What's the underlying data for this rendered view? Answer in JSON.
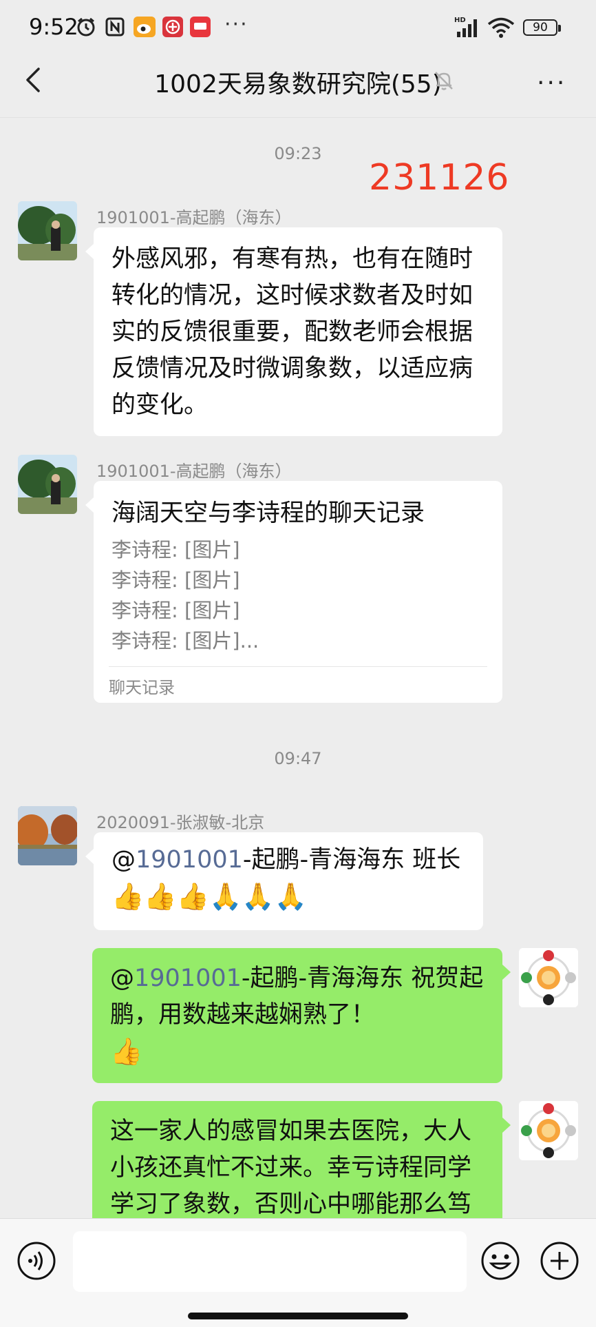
{
  "status_bar": {
    "time": "9:52",
    "battery": "90",
    "overflow": "···",
    "icons": [
      "alarm-icon",
      "nfc-icon",
      "weibo-icon",
      "app-icon",
      "news-app-icon",
      "hd-signal-icon",
      "wifi-icon",
      "battery-icon"
    ]
  },
  "header": {
    "title": "1002天易象数研究院(55)",
    "back_icon": "chevron-left-icon",
    "mute_icon": "bell-off-icon",
    "more_label": "···"
  },
  "stamp": "231126",
  "messages": [
    {
      "type": "time",
      "text": "09:23"
    },
    {
      "type": "text",
      "side": "left",
      "sender": "1901001-高起鹏（海东）",
      "lines": [
        "外感风邪，有寒有热，也有在随时",
        "转化的情况，这时候求数者及时如",
        "实的反馈很重要，配数老师会根据",
        "反馈情况及时微调象数，以适应病",
        "的变化。"
      ]
    },
    {
      "type": "record",
      "side": "left",
      "sender": "1901001-高起鹏（海东）",
      "title": "海阔天空与李诗程的聊天记录",
      "lines": [
        "李诗程: [图片]",
        "李诗程: [图片]",
        "李诗程: [图片]",
        "李诗程: [图片]..."
      ],
      "footer": "聊天记录"
    },
    {
      "type": "time",
      "text": "09:47"
    },
    {
      "type": "mention",
      "side": "left",
      "sender": "2020091-张淑敏-北京",
      "at": "@",
      "mention": "1901001",
      "text": "-起鹏-青海海东  班长",
      "emoji": "👍👍👍🙏🙏🙏"
    },
    {
      "type": "mention",
      "side": "right",
      "at": "@",
      "mention": "1901001",
      "line1": "-起鹏-青海海东  祝贺起",
      "line2": "鹏，用数越来越娴熟了！",
      "emoji": "👍"
    },
    {
      "type": "text",
      "side": "right",
      "lines": [
        "这一家人的感冒如果去医院，大人",
        "小孩还真忙不过来。幸亏诗程同学",
        "学习了象数，否则心中哪能那么笃"
      ]
    }
  ],
  "input_bar": {
    "voice_icon": "voice-icon",
    "emoji_icon": "smiley-icon",
    "plus_icon": "plus-circle-icon",
    "placeholder": ""
  },
  "colors": {
    "background": "#ededed",
    "bubble_self": "#95ec69",
    "bubble_other": "#ffffff",
    "mention": "#576b95",
    "stamp": "#ee3a24"
  }
}
